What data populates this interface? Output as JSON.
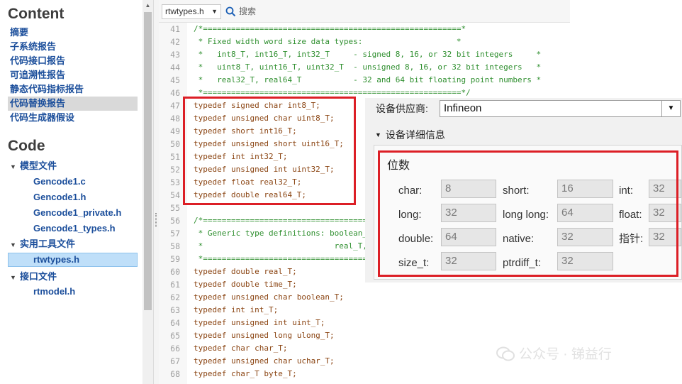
{
  "nav": {
    "content_heading": "Content",
    "content_links": [
      "摘要",
      "子系统报告",
      "代码接口报告",
      "可追溯性报告",
      "静态代码指标报告",
      "代码替换报告",
      "代码生成器假设"
    ],
    "active_link_index": 5,
    "code_heading": "Code",
    "groups": [
      {
        "label": "模型文件",
        "files": [
          "Gencode1.c",
          "Gencode1.h",
          "Gencode1_private.h",
          "Gencode1_types.h"
        ]
      },
      {
        "label": "实用工具文件",
        "files": [
          "rtwtypes.h"
        ]
      },
      {
        "label": "接口文件",
        "files": [
          "rtmodel.h"
        ]
      }
    ],
    "selected_file": "rtwtypes.h"
  },
  "toolbar": {
    "file_select_value": "rtwtypes.h",
    "search_placeholder": "搜索"
  },
  "code": {
    "lines": [
      {
        "num": "41",
        "text": "/*=======================================================*",
        "kind": "comment"
      },
      {
        "num": "42",
        "text": " * Fixed width word size data types:                    *",
        "kind": "comment"
      },
      {
        "num": "43",
        "text": " *   int8_T, int16_T, int32_T     - signed 8, 16, or 32 bit integers     *",
        "kind": "comment"
      },
      {
        "num": "44",
        "text": " *   uint8_T, uint16_T, uint32_T  - unsigned 8, 16, or 32 bit integers   *",
        "kind": "comment"
      },
      {
        "num": "45",
        "text": " *   real32_T, real64_T           - 32 and 64 bit floating point numbers *",
        "kind": "comment"
      },
      {
        "num": "46",
        "text": " *=======================================================*/",
        "kind": "comment"
      },
      {
        "num": "47",
        "text": "typedef signed char int8_T;",
        "kind": "code"
      },
      {
        "num": "48",
        "text": "typedef unsigned char uint8_T;",
        "kind": "code"
      },
      {
        "num": "49",
        "text": "typedef short int16_T;",
        "kind": "code"
      },
      {
        "num": "50",
        "text": "typedef unsigned short uint16_T;",
        "kind": "code"
      },
      {
        "num": "51",
        "text": "typedef int int32_T;",
        "kind": "code"
      },
      {
        "num": "52",
        "text": "typedef unsigned int uint32_T;",
        "kind": "code"
      },
      {
        "num": "53",
        "text": "typedef float real32_T;",
        "kind": "code"
      },
      {
        "num": "54",
        "text": "typedef double real64_T;",
        "kind": "code"
      },
      {
        "num": "55",
        "text": "",
        "kind": "code"
      },
      {
        "num": "56",
        "text": "/*=================================================",
        "kind": "comment"
      },
      {
        "num": "57",
        "text": " * Generic type definitions: boolean_",
        "kind": "comment"
      },
      {
        "num": "58",
        "text": " *                            real_T,",
        "kind": "comment"
      },
      {
        "num": "59",
        "text": " *=================================================",
        "kind": "comment"
      },
      {
        "num": "60",
        "text": "typedef double real_T;",
        "kind": "code"
      },
      {
        "num": "61",
        "text": "typedef double time_T;",
        "kind": "code"
      },
      {
        "num": "62",
        "text": "typedef unsigned char boolean_T;",
        "kind": "code"
      },
      {
        "num": "63",
        "text": "typedef int int_T;",
        "kind": "code"
      },
      {
        "num": "64",
        "text": "typedef unsigned int uint_T;",
        "kind": "code"
      },
      {
        "num": "65",
        "text": "typedef unsigned long ulong_T;",
        "kind": "code"
      },
      {
        "num": "66",
        "text": "typedef char char_T;",
        "kind": "code"
      },
      {
        "num": "67",
        "text": "typedef unsigned char uchar_T;",
        "kind": "code"
      },
      {
        "num": "68",
        "text": "typedef char_T byte_T;",
        "kind": "code"
      }
    ]
  },
  "settings": {
    "vendor_label": "设备供应商:",
    "vendor_value": "Infineon",
    "details_label": "设备详细信息",
    "bits_title": "位数",
    "fields": [
      {
        "label": "char:",
        "value": "8"
      },
      {
        "label": "short:",
        "value": "16"
      },
      {
        "label": "int:",
        "value": "32"
      },
      {
        "label": "long:",
        "value": "32"
      },
      {
        "label": "long long:",
        "value": "64"
      },
      {
        "label": "float:",
        "value": "32"
      },
      {
        "label": "double:",
        "value": "64"
      },
      {
        "label": "native:",
        "value": "32"
      },
      {
        "label": "指针:",
        "value": "32"
      },
      {
        "label": "size_t:",
        "value": "32"
      },
      {
        "label": "ptrdiff_t:",
        "value": "32"
      }
    ]
  },
  "watermark": "公众号 · 锑益行",
  "colors": {
    "link": "#1b4e9b",
    "highlight_frame": "#dc1f26",
    "code_keyword": "#8b4513",
    "code_comment": "#2f8f2f"
  }
}
